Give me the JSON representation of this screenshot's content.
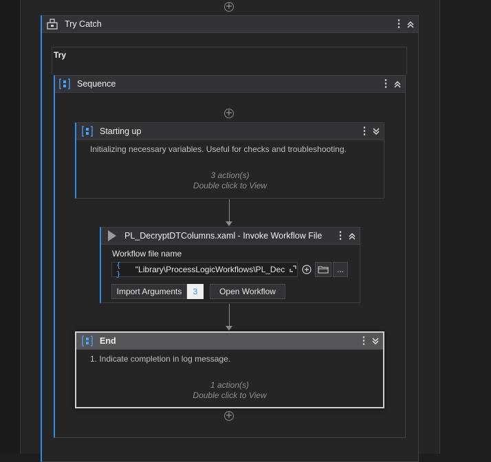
{
  "try_catch": {
    "title": "Try Catch",
    "try_label": "Try"
  },
  "sequence": {
    "title": "Sequence"
  },
  "starting_up": {
    "title": "Starting up",
    "description": "Initializing necessary variables. Useful for checks and troubleshooting.",
    "actions": "3 action(s)",
    "hint": "Double click to View"
  },
  "invoke": {
    "title": "PL_DecryptDTColumns.xaml - Invoke Workflow File",
    "field_label": "Workflow file name",
    "field_prefix": "{ }",
    "field_value": "\"Library\\ProcessLogicWorkflows\\PL_Decry",
    "import_label": "Import Arguments",
    "import_count": "3",
    "open_label": "Open Workflow",
    "ellipsis": "..."
  },
  "end": {
    "title": "End",
    "description": "1. Indicate completion in log message.",
    "actions": "1 action(s)",
    "hint": "Double click to View"
  },
  "icons": {
    "add": "+",
    "kebab": "⋮"
  },
  "colors": {
    "accent": "#2f8fe6",
    "background": "#252526",
    "header": "#333337"
  }
}
